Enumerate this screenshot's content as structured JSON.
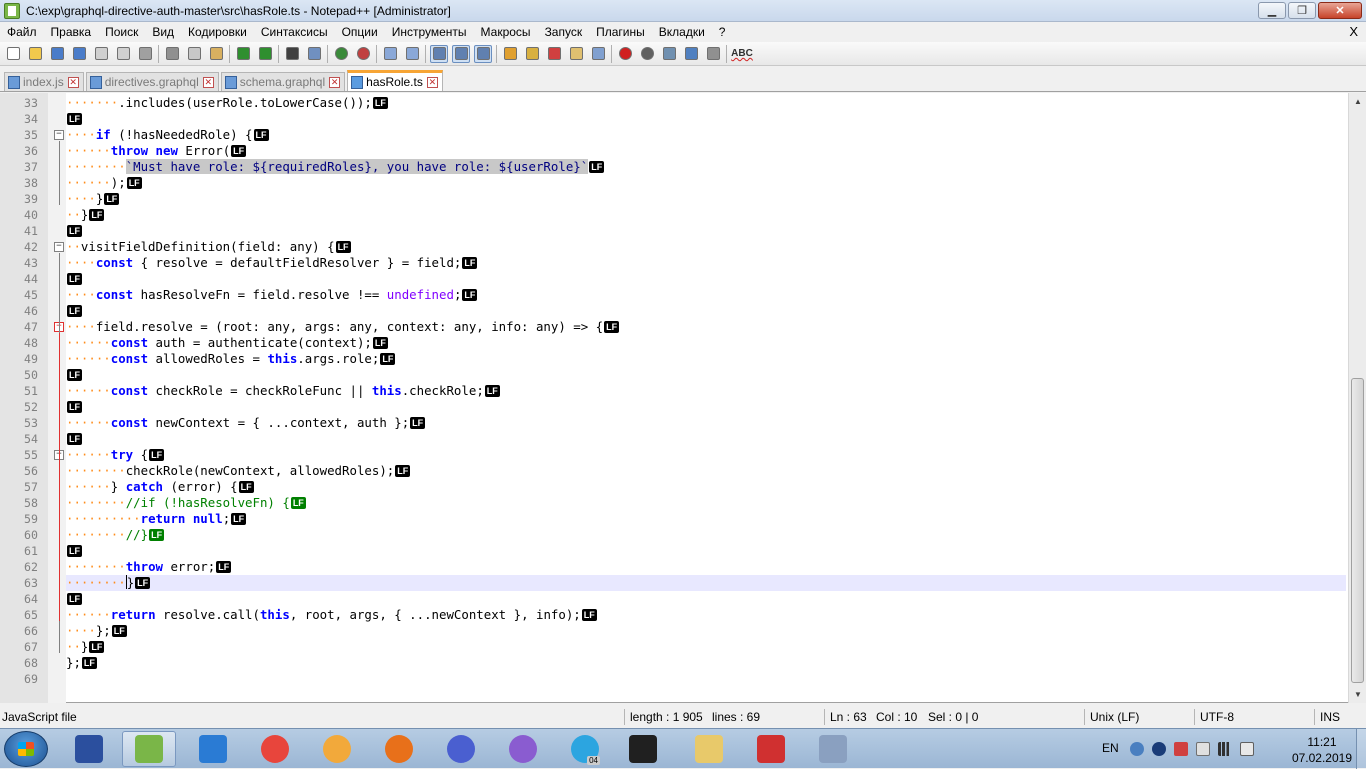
{
  "window": {
    "title": "C:\\exp\\graphql-directive-auth-master\\src\\hasRole.ts - Notepad++ [Administrator]",
    "minimize": "▁",
    "maximize": "❐",
    "close": "✕"
  },
  "menu": [
    "Файл",
    "Правка",
    "Поиск",
    "Вид",
    "Кодировки",
    "Синтаксисы",
    "Опции",
    "Инструменты",
    "Макросы",
    "Запуск",
    "Плагины",
    "Вкладки",
    "?"
  ],
  "menu_close": "X",
  "toolbar": {
    "icons": [
      "new-file-icon",
      "open-file-icon",
      "save-icon",
      "save-all-icon",
      "close-icon",
      "close-all-icon",
      "print-icon",
      "sep",
      "cut-icon",
      "copy-icon",
      "paste-icon",
      "sep",
      "undo-icon",
      "redo-icon",
      "sep",
      "find-icon",
      "replace-icon",
      "sep",
      "zoom-in-icon",
      "zoom-out-icon",
      "sep",
      "sync-v-icon",
      "sync-h-icon",
      "sep",
      "word-wrap-icon",
      "show-all-chars-icon",
      "indent-guide-icon",
      "sep",
      "udl-icon",
      "doc-map-icon",
      "function-list-icon",
      "folder-workspace-icon",
      "monitor-icon",
      "sep",
      "record-macro-icon",
      "stop-record-icon",
      "play-macro-icon",
      "run-macro-multiple-icon",
      "save-macro-icon",
      "sep",
      "spellcheck-icon"
    ],
    "spellcheck_label": "ABC"
  },
  "tabs": [
    {
      "label": "index.js",
      "active": false
    },
    {
      "label": "directives.graphql",
      "active": false
    },
    {
      "label": "schema.graphql",
      "active": false
    },
    {
      "label": "hasRole.ts",
      "active": true
    }
  ],
  "editor": {
    "lines": [
      {
        "n": "33",
        "d": "·······",
        "html": ".includes(userRole.toLowerCase());",
        "lf": "LF"
      },
      {
        "n": "34",
        "d": "",
        "html": "",
        "lf": "LF"
      },
      {
        "n": "35",
        "d": "····",
        "html": "if (!hasNeededRole) {",
        "lf": "LF"
      },
      {
        "n": "36",
        "d": "······",
        "html": "throw new Error(",
        "lf": "LF"
      },
      {
        "n": "37",
        "d": "········",
        "html": "`Must have role: ${requiredRoles}, you have role: ${userRole}`",
        "lf": "LF"
      },
      {
        "n": "38",
        "d": "······",
        "html": ");",
        "lf": "LF"
      },
      {
        "n": "39",
        "d": "····",
        "html": "}",
        "lf": "LF"
      },
      {
        "n": "40",
        "d": "··",
        "html": "}",
        "lf": "LF"
      },
      {
        "n": "41",
        "d": "",
        "html": "",
        "lf": "LF"
      },
      {
        "n": "42",
        "d": "··",
        "html": "visitFieldDefinition(field: any) {",
        "lf": "LF"
      },
      {
        "n": "43",
        "d": "····",
        "html": "const { resolve = defaultFieldResolver } = field;",
        "lf": "LF"
      },
      {
        "n": "44",
        "d": "",
        "html": "",
        "lf": "LF"
      },
      {
        "n": "45",
        "d": "····",
        "html": "const hasResolveFn = field.resolve !== undefined;",
        "lf": "LF"
      },
      {
        "n": "46",
        "d": "",
        "html": "",
        "lf": "LF"
      },
      {
        "n": "47",
        "d": "····",
        "html": "field.resolve = (root: any, args: any, context: any, info: any) => {",
        "lf": "LF"
      },
      {
        "n": "48",
        "d": "······",
        "html": "const auth = authenticate(context);",
        "lf": "LF"
      },
      {
        "n": "49",
        "d": "······",
        "html": "const allowedRoles = this.args.role;",
        "lf": "LF"
      },
      {
        "n": "50",
        "d": "",
        "html": "",
        "lf": "LF"
      },
      {
        "n": "51",
        "d": "······",
        "html": "const checkRole = checkRoleFunc || this.checkRole;",
        "lf": "LF"
      },
      {
        "n": "52",
        "d": "",
        "html": "",
        "lf": "LF"
      },
      {
        "n": "53",
        "d": "······",
        "html": "const newContext = { ...context, auth };",
        "lf": "LF"
      },
      {
        "n": "54",
        "d": "",
        "html": "",
        "lf": "LF"
      },
      {
        "n": "55",
        "d": "······",
        "html": "try {",
        "lf": "LF"
      },
      {
        "n": "56",
        "d": "········",
        "html": "checkRole(newContext, allowedRoles);",
        "lf": "LF"
      },
      {
        "n": "57",
        "d": "······",
        "html": "} catch (error) {",
        "lf": "LF"
      },
      {
        "n": "58",
        "d": "········",
        "html": "//if (!hasResolveFn) {",
        "lf": "LF"
      },
      {
        "n": "59",
        "d": "··········",
        "html": "return null;",
        "lf": "LF"
      },
      {
        "n": "60",
        "d": "········",
        "html": "//}",
        "lf": "LF"
      },
      {
        "n": "61",
        "d": "",
        "html": "",
        "lf": "LF"
      },
      {
        "n": "62",
        "d": "········",
        "html": "throw error;",
        "lf": "LF"
      },
      {
        "n": "63",
        "d": "········",
        "html": "}",
        "lf": "LF"
      },
      {
        "n": "64",
        "d": "",
        "html": "",
        "lf": "LF"
      },
      {
        "n": "65",
        "d": "······",
        "html": "return resolve.call(this, root, args, { ...newContext }, info);",
        "lf": "LF"
      },
      {
        "n": "66",
        "d": "····",
        "html": "};",
        "lf": "LF"
      },
      {
        "n": "67",
        "d": "··",
        "html": "}",
        "lf": "LF"
      },
      {
        "n": "68",
        "d": "",
        "html": "};",
        "lf": "LF"
      },
      {
        "n": "69",
        "d": "",
        "html": "",
        "lf": ""
      }
    ]
  },
  "statusbar": {
    "file_type": "JavaScript file",
    "length": "length : 1 905",
    "lines": "lines : 69",
    "ln": "Ln : 63",
    "col": "Col : 10",
    "sel": "Sel : 0 | 0",
    "eol": "Unix (LF)",
    "encoding": "UTF-8",
    "mode": "INS"
  },
  "taskbar": {
    "apps": [
      "floppy-disk-icon",
      "notepad-plus-plus-icon",
      "vscode-icon",
      "chrome-icon",
      "chromium-icon",
      "firefox-icon",
      "firefox-dev-icon",
      "cat-icon",
      "telegram-icon",
      "cmd-icon",
      "explorer-icon",
      "ccleaner-icon",
      "scanner-icon"
    ],
    "telegram_badge": "04",
    "lang": "EN",
    "time": "11:21",
    "date": "07.02.2019"
  },
  "colors": {
    "keyword": "#0000ff",
    "string": "#000080",
    "comment": "#008000",
    "indent_dots": "#ff8c1a",
    "current_line": "#e8e8ff",
    "active_tab_accent": "#f7a535"
  }
}
